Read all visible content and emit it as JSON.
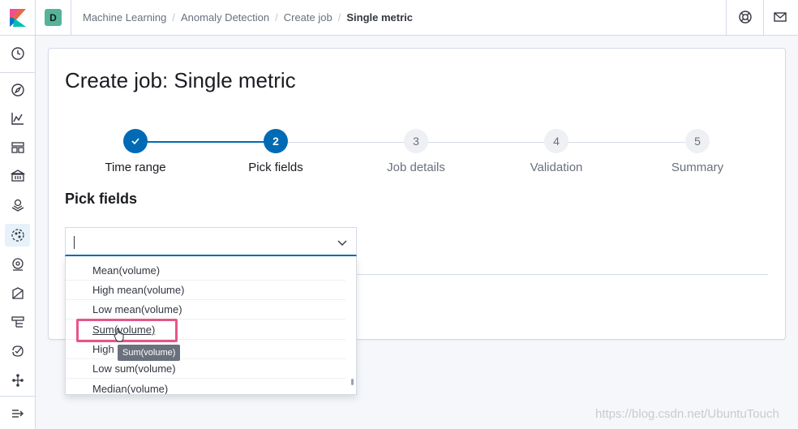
{
  "app": {
    "space_initial": "D"
  },
  "breadcrumbs": [
    "Machine Learning",
    "Anomaly Detection",
    "Create job",
    "Single metric"
  ],
  "page": {
    "title": "Create job: Single metric",
    "section_title": "Pick fields"
  },
  "steps": [
    {
      "number": "✓",
      "label": "Time range",
      "state": "done"
    },
    {
      "number": "2",
      "label": "Pick fields",
      "state": "current"
    },
    {
      "number": "3",
      "label": "Job details",
      "state": "todo"
    },
    {
      "number": "4",
      "label": "Validation",
      "state": "todo"
    },
    {
      "number": "5",
      "label": "Summary",
      "state": "todo"
    }
  ],
  "combobox": {
    "value": ""
  },
  "options": [
    "Mean(volume)",
    "High mean(volume)",
    "Low mean(volume)",
    "Sum(volume)",
    "High",
    "Low sum(volume)",
    "Median(volume)"
  ],
  "tooltip": "Sum(volume)",
  "watermark": "https://blog.csdn.net/UbuntuTouch",
  "colors": {
    "accent": "#006bb4",
    "highlight": "#e6558a",
    "space": "#54b399"
  },
  "icons": {
    "header": [
      "help-icon",
      "mail-icon"
    ],
    "nav": [
      "recent-clock-icon",
      "discover-compass-icon",
      "visualize-icon",
      "dashboard-icon",
      "canvas-icon",
      "maps-icon",
      "machine-learning-icon",
      "uptime-icon",
      "siem-icon",
      "logs-icon",
      "apm-icon",
      "graph-icon",
      "collapse-nav-icon"
    ]
  }
}
